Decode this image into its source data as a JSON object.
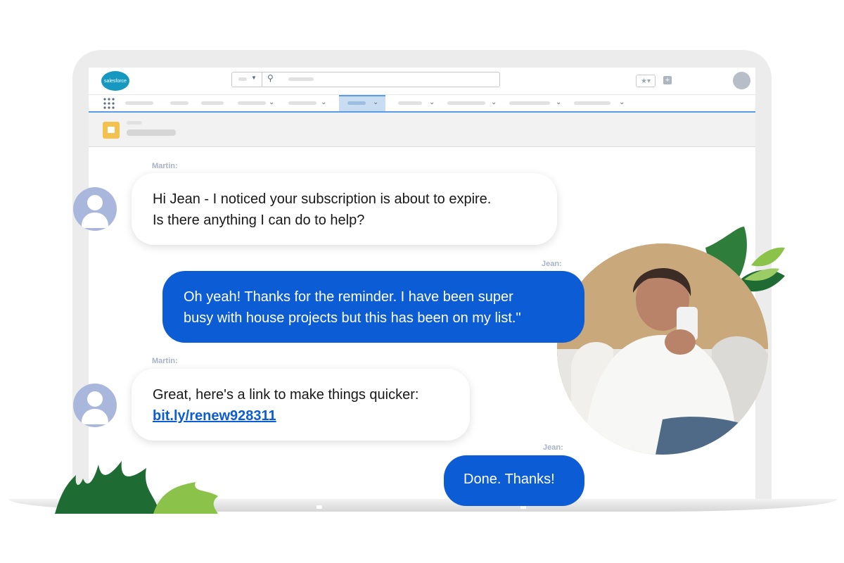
{
  "app": {
    "logo_text": "salesforce",
    "colors": {
      "brand": "#1798c1",
      "accent": "#0b5cd5",
      "nav_rule": "#5a9be6",
      "record_icon": "#f2c14e"
    }
  },
  "header": {
    "search_icon": "search-icon",
    "favorites_icon": "star-icon",
    "add_icon": "plus-icon",
    "user_icon": "avatar"
  },
  "chat": {
    "messages": [
      {
        "sender": "Martin:",
        "text_line1": "Hi Jean - I noticed your subscription is about to expire.",
        "text_line2": "Is there anything I can do to help?"
      },
      {
        "sender": "Jean:",
        "text_line1": "Oh yeah! Thanks for the reminder. I have been super",
        "text_line2": "busy with house projects but this has been on my list.\""
      },
      {
        "sender": "Martin:",
        "text_line1": "Great, here's a link to make things quicker:",
        "link": "bit.ly/renew928311"
      },
      {
        "sender": "Jean:",
        "text": "Done. Thanks!"
      }
    ]
  }
}
